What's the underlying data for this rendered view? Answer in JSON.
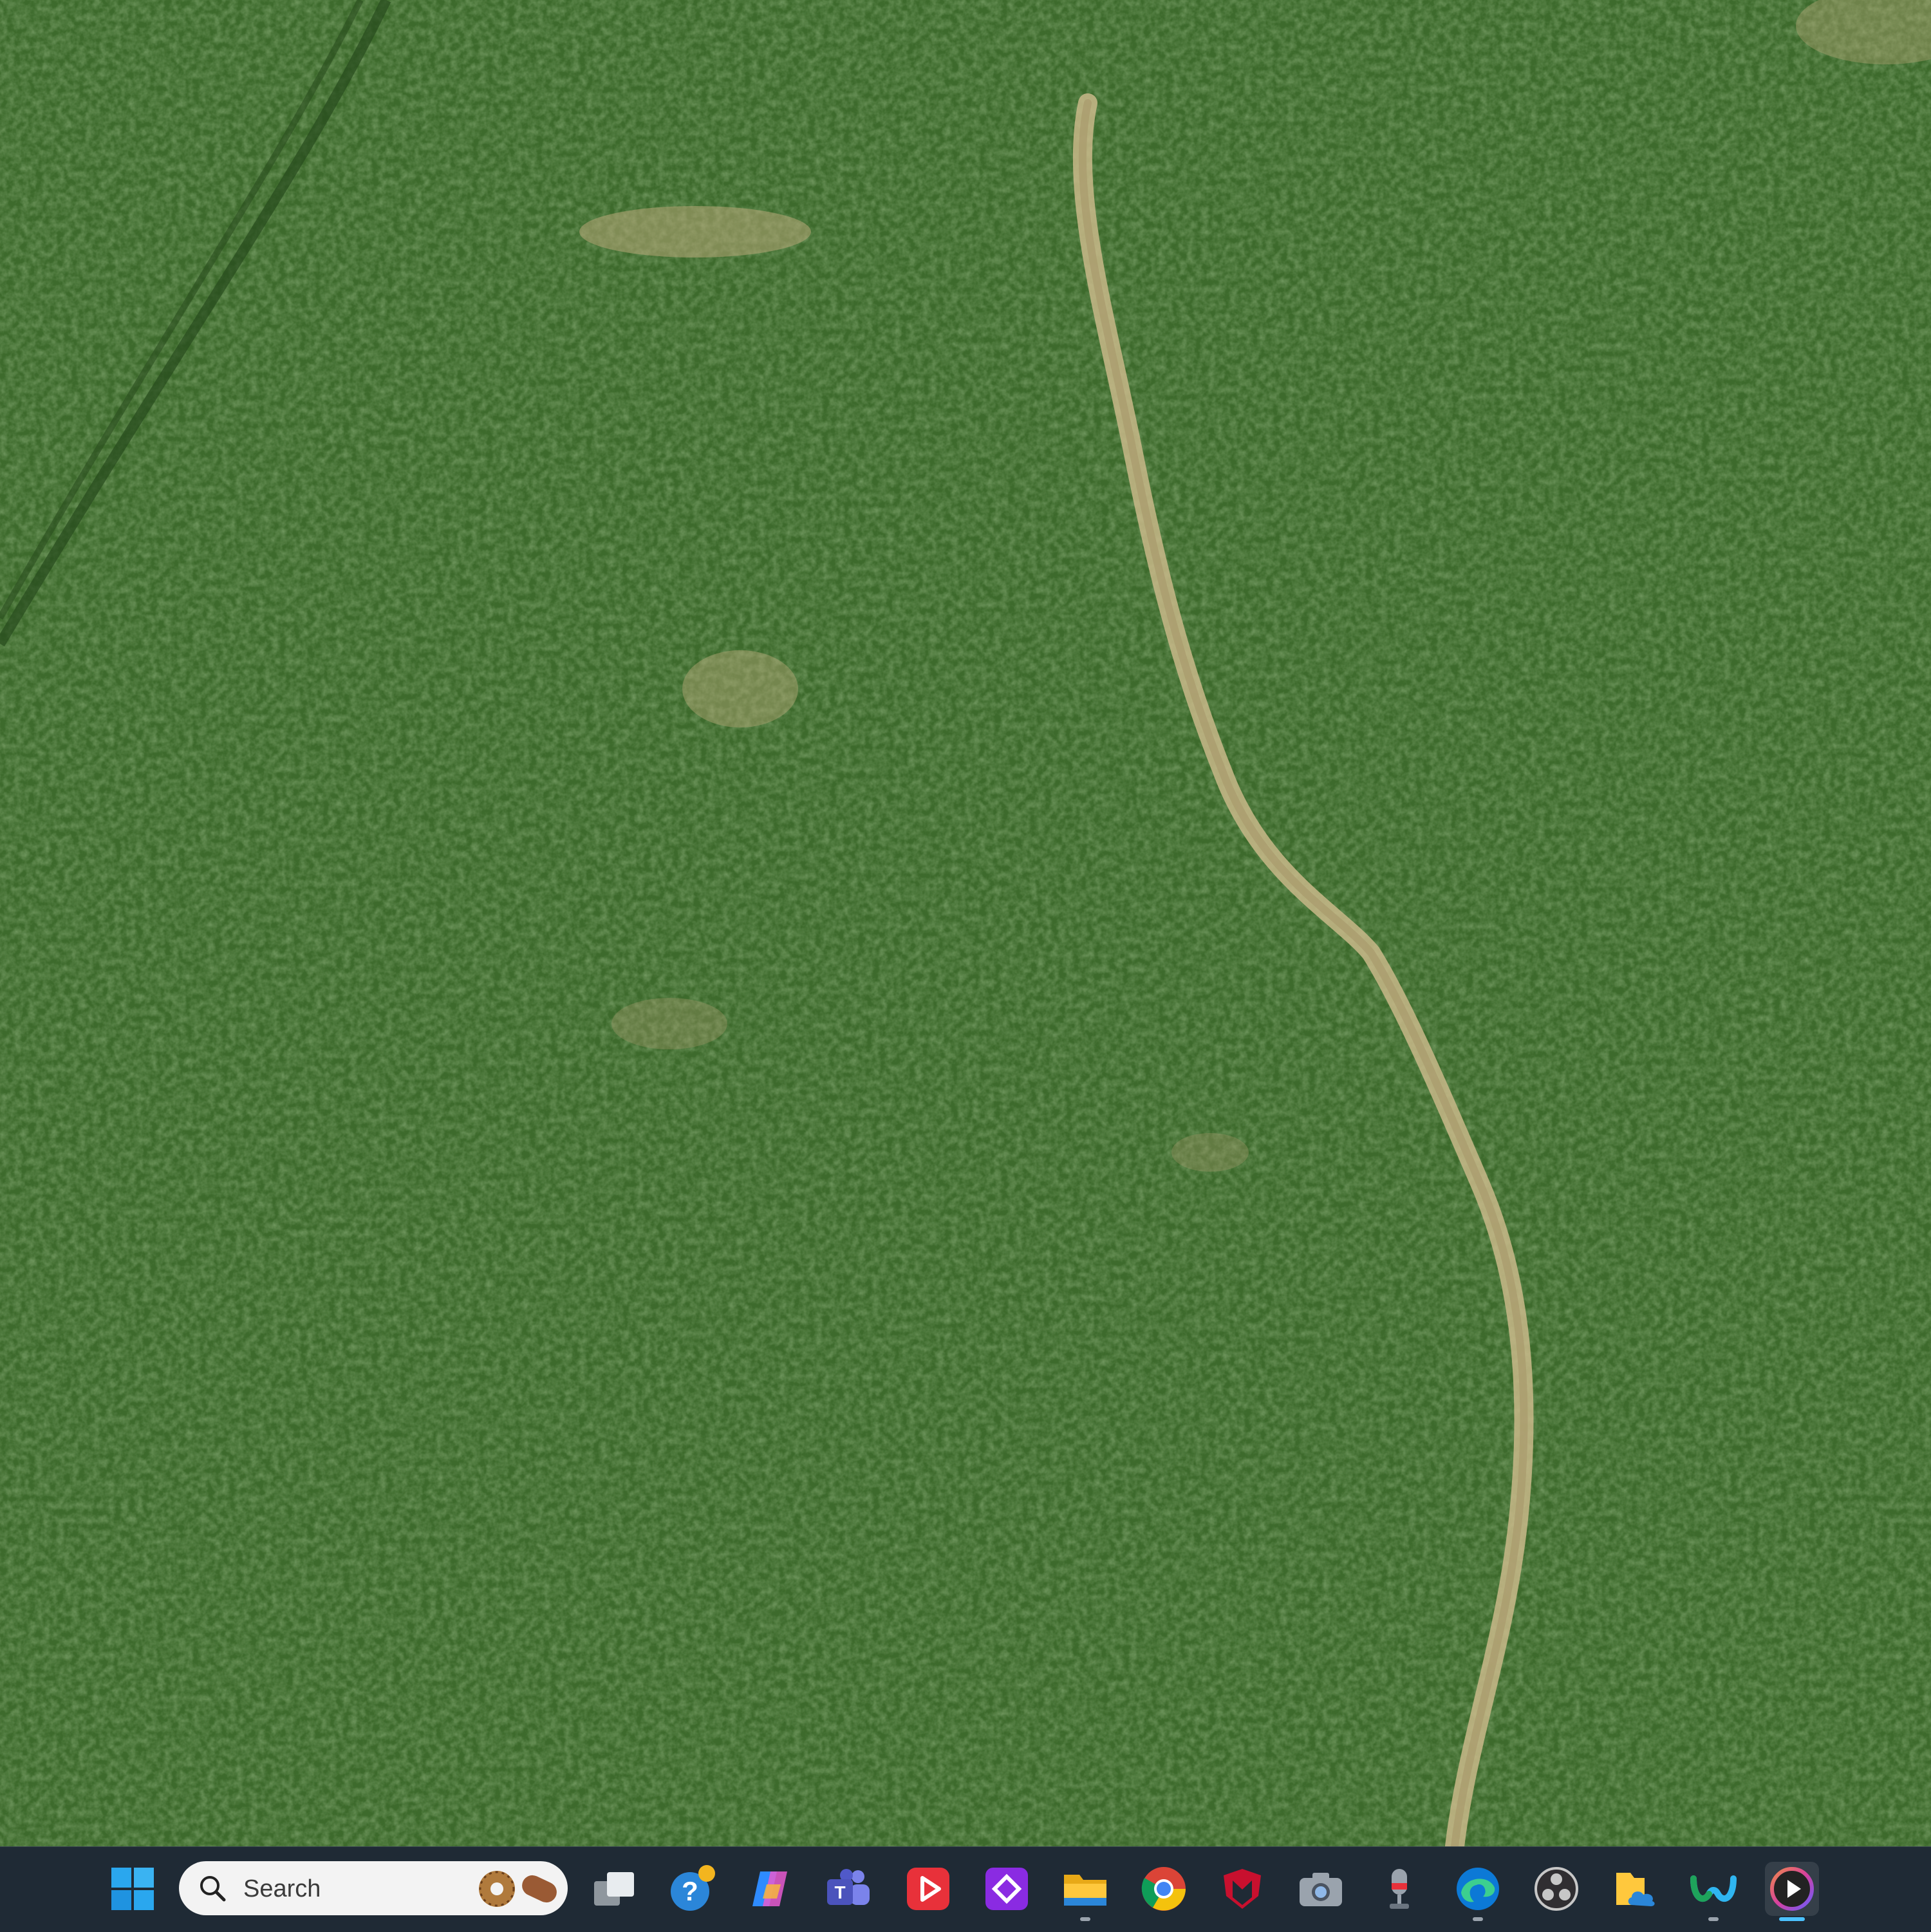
{
  "desktop": {
    "wallpaper": "aerial-grass-field"
  },
  "taskbar": {
    "search": {
      "placeholder": "Search"
    },
    "icons": [
      {
        "name": "start-button",
        "icon": "windows-logo-icon"
      },
      {
        "name": "task-view-button",
        "icon": "task-view-icon"
      },
      {
        "name": "get-help-app",
        "icon": "help-question-icon"
      },
      {
        "name": "copilot-app",
        "icon": "copilot-icon"
      },
      {
        "name": "teams-app",
        "icon": "teams-icon"
      },
      {
        "name": "video-player-app",
        "icon": "red-play-icon"
      },
      {
        "name": "purple-diamond-app",
        "icon": "purple-diamond-icon"
      },
      {
        "name": "file-explorer-app",
        "icon": "folder-icon"
      },
      {
        "name": "chrome-app",
        "icon": "chrome-icon"
      },
      {
        "name": "mcafee-app",
        "icon": "mcafee-shield-icon"
      },
      {
        "name": "camera-app",
        "icon": "camera-icon"
      },
      {
        "name": "voice-recorder-app",
        "icon": "microphone-icon"
      },
      {
        "name": "edge-app",
        "icon": "edge-icon"
      },
      {
        "name": "obs-app",
        "icon": "obs-icon"
      },
      {
        "name": "files-cloud-app",
        "icon": "cloud-folder-icon"
      },
      {
        "name": "webex-app",
        "icon": "webex-icon"
      },
      {
        "name": "media-player-app",
        "icon": "media-player-icon"
      }
    ],
    "colors": {
      "background": "#1f2a35",
      "active_indicator": "#4cc2ff",
      "indicator": "#9aa3ad"
    }
  }
}
